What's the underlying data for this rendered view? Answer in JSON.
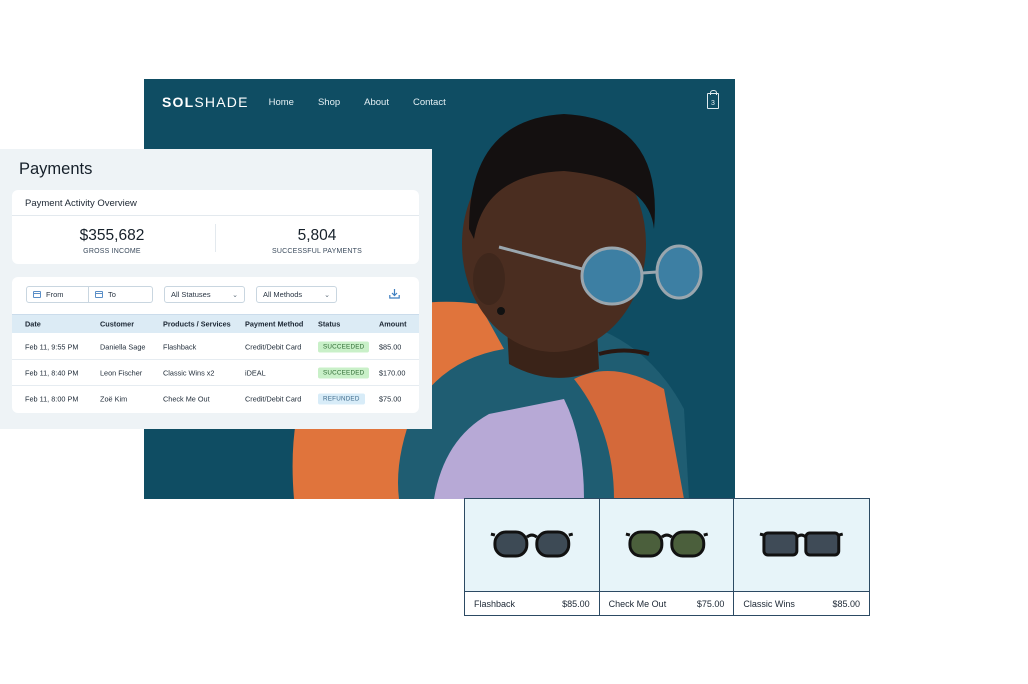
{
  "store": {
    "logo_bold": "SOL",
    "logo_light": "SHADE",
    "nav": [
      "Home",
      "Shop",
      "About",
      "Contact"
    ],
    "cart_count": "3",
    "hero_bg_color": "#0f4d63"
  },
  "payments": {
    "title": "Payments",
    "overview": {
      "title": "Payment Activity Overview",
      "gross_income": "$355,682",
      "gross_income_label": "GROSS INCOME",
      "successful_payments": "5,804",
      "successful_payments_label": "SUCCESSFUL PAYMENTS"
    },
    "filters": {
      "from": "From",
      "to": "To",
      "status": "All Statuses",
      "method": "All Methods"
    },
    "columns": [
      "Date",
      "Customer",
      "Products / Services",
      "Payment Method",
      "Status",
      "Amount"
    ],
    "rows": [
      {
        "date": "Feb 11,  9:55 PM",
        "customer": "Daniella Sage",
        "product": "Flashback",
        "method": "Credit/Debit Card",
        "status": "SUCCEEDED",
        "amount": "$85.00"
      },
      {
        "date": "Feb 11,  8:40 PM",
        "customer": "Leon Fischer",
        "product": "Classic Wins x2",
        "method": "iDEAL",
        "status": "SUCCEEDED",
        "amount": "$170.00"
      },
      {
        "date": "Feb 11,  8:00 PM",
        "customer": "Zoë Kim",
        "product": "Check Me Out",
        "method": "Credit/Debit Card",
        "status": "REFUNDED",
        "amount": "$75.00"
      }
    ]
  },
  "products": [
    {
      "name": "Flashback",
      "price": "$85.00",
      "lens_color": "#3d4a55"
    },
    {
      "name": "Check Me Out",
      "price": "$75.00",
      "lens_color": "#4b5f3c"
    },
    {
      "name": "Classic Wins",
      "price": "$85.00",
      "lens_color": "#3f4b57"
    }
  ],
  "colors": {
    "succeeded_bg": "#c9f0c8",
    "refunded_bg": "#d8ecf8",
    "accent": "#2c4a63"
  }
}
